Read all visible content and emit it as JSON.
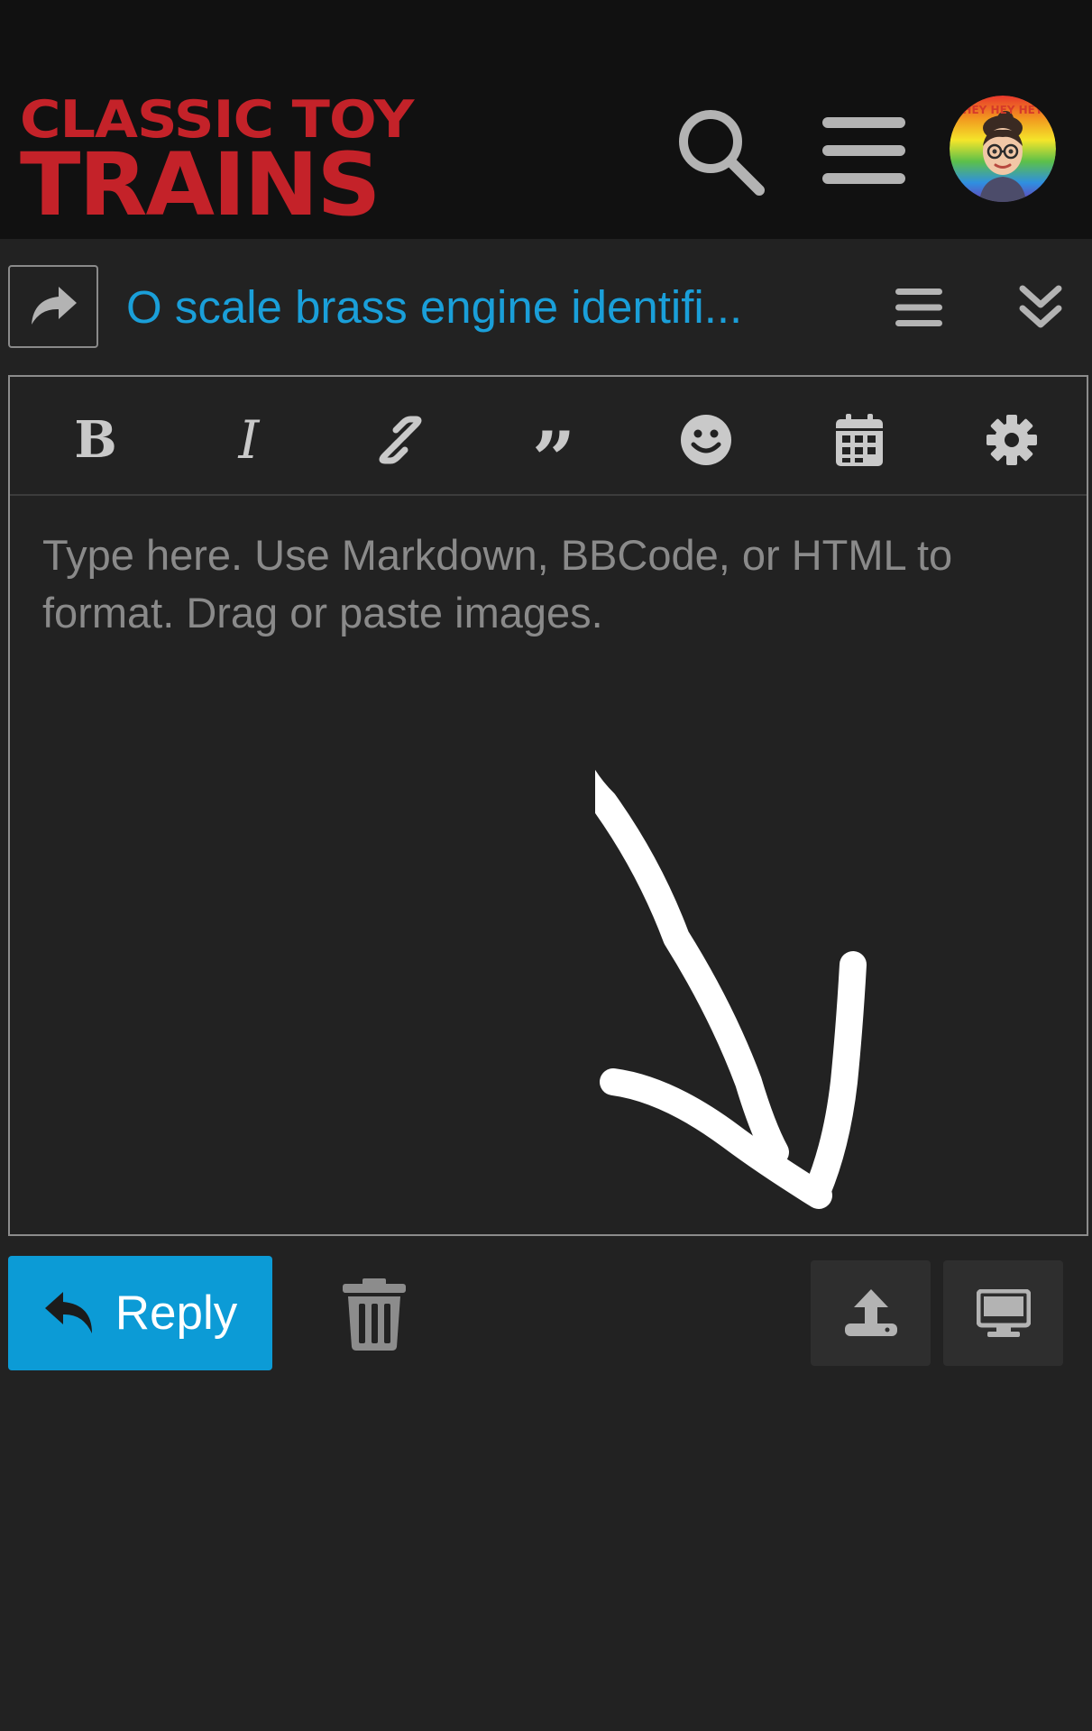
{
  "header": {
    "logo": {
      "line1": "CLASSIC TOY",
      "line2": "TRAINS"
    },
    "icons": [
      "search-icon",
      "hamburger-menu-icon",
      "user-avatar"
    ],
    "avatar_text": "HEY HEY HEY"
  },
  "topic": {
    "title": "O scale brass engine identifi...",
    "icons": [
      "reply-arrow-icon",
      "topic-menu-icon",
      "collapse-chevrons-icon"
    ]
  },
  "editor": {
    "toolbar": {
      "bold_label": "B",
      "italic_label": "I",
      "quote_label": "”",
      "icons": [
        "link-icon",
        "emoji-icon",
        "calendar-icon",
        "gear-icon"
      ]
    },
    "placeholder": "Type here. Use Markdown, BBCode, or HTML to format. Drag or paste images."
  },
  "actions": {
    "reply_label": "Reply",
    "icons": [
      "reply-icon",
      "trash-icon",
      "upload-icon",
      "desktop-preview-icon"
    ]
  },
  "colors": {
    "background": "#222222",
    "header_bg": "#111111",
    "accent": "#0c9bd6",
    "link": "#1a9fd9",
    "logo_red": "#c42229"
  }
}
